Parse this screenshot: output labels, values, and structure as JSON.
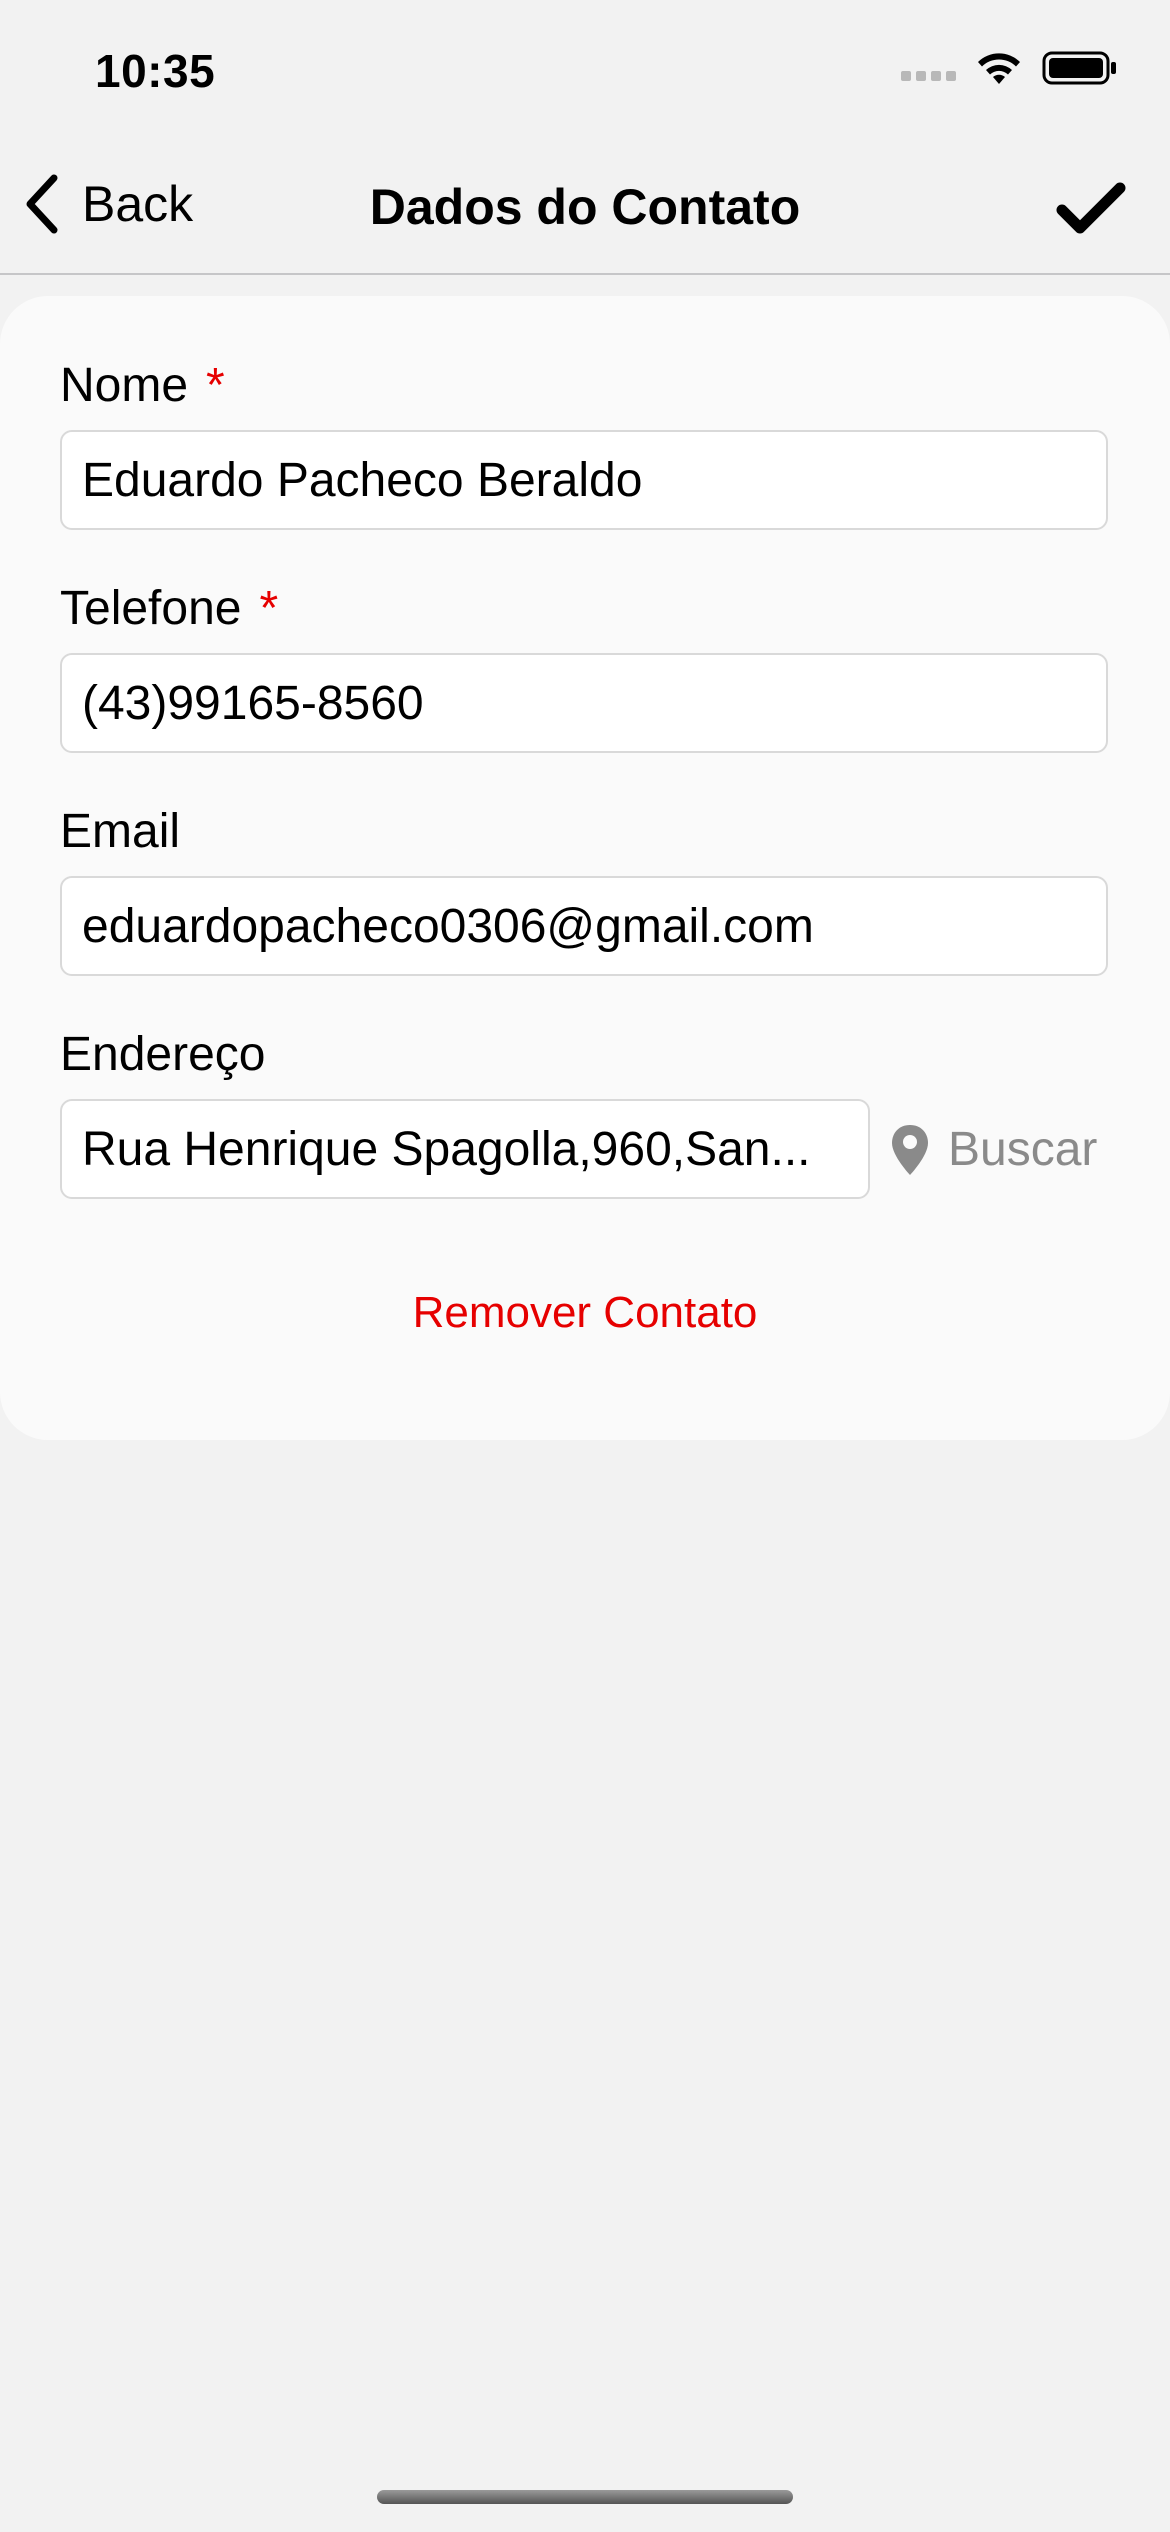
{
  "status_bar": {
    "time": "10:35",
    "icons": [
      "signal-icon",
      "wifi-icon",
      "battery-icon"
    ]
  },
  "nav": {
    "back_label": "Back",
    "title": "Dados do Contato",
    "confirm_icon": "checkmark-icon"
  },
  "form": {
    "name": {
      "label": "Nome",
      "required_mark": "*",
      "value": "Eduardo Pacheco Beraldo"
    },
    "phone": {
      "label": "Telefone",
      "required_mark": "*",
      "value": "(43)99165-8560"
    },
    "email": {
      "label": "Email",
      "value": "eduardopacheco0306@gmail.com"
    },
    "address": {
      "label": "Endereço",
      "value": "Rua Henrique Spagolla,960,San...",
      "search_label": "Buscar",
      "search_icon": "map-pin-icon"
    },
    "remove_label": "Remover Contato"
  },
  "colors": {
    "required": "#e60000",
    "remove": "#e60000",
    "background": "#f2f2f2",
    "card": "#fafafa",
    "muted": "#8a8a8a"
  }
}
